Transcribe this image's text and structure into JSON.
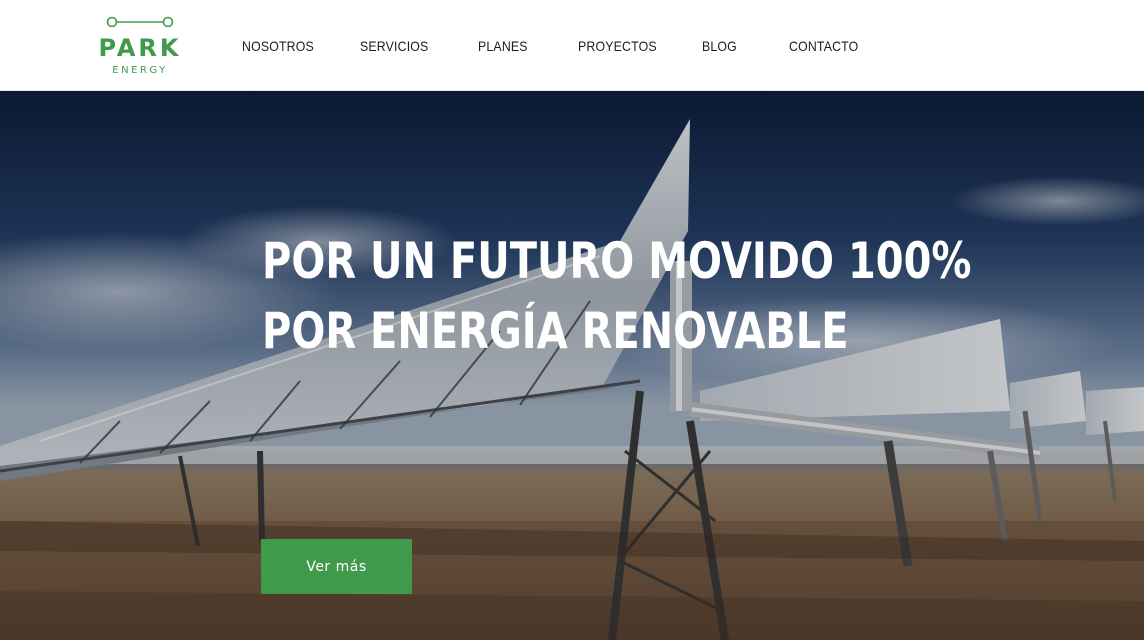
{
  "brand": {
    "name": "PARK",
    "tagline": "ENERGY",
    "color": "#3f9a4c",
    "icon": "circuit-line-logo-icon"
  },
  "nav": {
    "items": [
      {
        "label": "NOSOTROS"
      },
      {
        "label": "SERVICIOS"
      },
      {
        "label": "PLANES"
      },
      {
        "label": "PROYECTOS"
      },
      {
        "label": "BLOG"
      },
      {
        "label": "CONTACTO"
      }
    ]
  },
  "hero": {
    "title_line1": "POR UN FUTURO MOVIDO 100%",
    "title_line2": "POR ENERGÍA RENOVABLE",
    "cta_label": "Ver más",
    "cta_color": "#3f9a4c",
    "background": "solar-thermal-parabolic-trough-field-photo"
  }
}
